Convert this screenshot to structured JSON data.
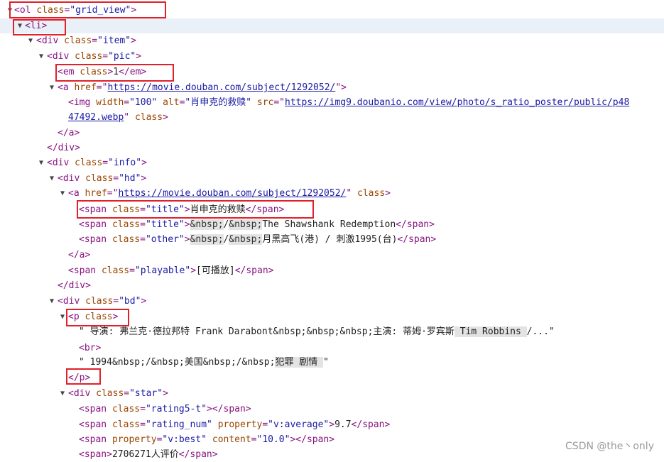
{
  "lines": [
    {
      "arrow": "▼",
      "pieces": [
        [
          "t",
          "<ol "
        ],
        [
          "a",
          "class"
        ],
        [
          "t",
          "="
        ],
        [
          "v",
          "\"grid_view\""
        ],
        [
          "t",
          ">"
        ]
      ]
    },
    {
      "arrow": "▼",
      "selected": true,
      "pieces": [
        [
          "t",
          "<li>"
        ]
      ]
    },
    {
      "arrow": "▼",
      "pieces": [
        [
          "t",
          "<div "
        ],
        [
          "a",
          "class"
        ],
        [
          "t",
          "="
        ],
        [
          "v",
          "\"item\""
        ],
        [
          "t",
          ">"
        ]
      ]
    },
    {
      "arrow": "▼",
      "pieces": [
        [
          "t",
          "<div "
        ],
        [
          "a",
          "class"
        ],
        [
          "t",
          "="
        ],
        [
          "v",
          "\"pic\""
        ],
        [
          "t",
          ">"
        ]
      ]
    },
    {
      "pieces": [
        [
          "t",
          "<em "
        ],
        [
          "a",
          "class"
        ],
        [
          "t",
          ">"
        ],
        [
          "x",
          "1"
        ],
        [
          "t",
          "</em>"
        ]
      ]
    },
    {
      "arrow": "▼",
      "pieces": [
        [
          "t",
          "<a "
        ],
        [
          "a",
          "href"
        ],
        [
          "t",
          "=\""
        ],
        [
          "l",
          "https://movie.douban.com/subject/1292052/"
        ],
        [
          "t",
          "\">"
        ]
      ]
    },
    {
      "pieces": [
        [
          "t",
          "<img "
        ],
        [
          "a",
          "width"
        ],
        [
          "t",
          "="
        ],
        [
          "v",
          "\"100\""
        ],
        [
          "x",
          " "
        ],
        [
          "a",
          "alt"
        ],
        [
          "t",
          "="
        ],
        [
          "v",
          "\"肖申克的救赎\""
        ],
        [
          "x",
          " "
        ],
        [
          "a",
          "src"
        ],
        [
          "t",
          "=\""
        ],
        [
          "l",
          "https://img9.doubanio.com/view/photo/s_ratio_poster/public/p48"
        ]
      ]
    },
    {
      "pieces": [
        [
          "l",
          "47492.webp"
        ],
        [
          "t",
          "\""
        ],
        [
          "x",
          " "
        ],
        [
          "a",
          "class"
        ],
        [
          "t",
          ">"
        ]
      ]
    },
    {
      "pieces": [
        [
          "t",
          "</a>"
        ]
      ]
    },
    {
      "pieces": [
        [
          "t",
          "</div>"
        ]
      ]
    },
    {
      "arrow": "▼",
      "pieces": [
        [
          "t",
          "<div "
        ],
        [
          "a",
          "class"
        ],
        [
          "t",
          "="
        ],
        [
          "v",
          "\"info\""
        ],
        [
          "t",
          ">"
        ]
      ]
    },
    {
      "arrow": "▼",
      "pieces": [
        [
          "t",
          "<div "
        ],
        [
          "a",
          "class"
        ],
        [
          "t",
          "="
        ],
        [
          "v",
          "\"hd\""
        ],
        [
          "t",
          ">"
        ]
      ]
    },
    {
      "arrow": "▼",
      "pieces": [
        [
          "t",
          "<a "
        ],
        [
          "a",
          "href"
        ],
        [
          "t",
          "=\""
        ],
        [
          "l",
          "https://movie.douban.com/subject/1292052/"
        ],
        [
          "t",
          "\""
        ],
        [
          "x",
          " "
        ],
        [
          "a",
          "class"
        ],
        [
          "t",
          ">"
        ]
      ]
    },
    {
      "pieces": [
        [
          "t",
          "<span "
        ],
        [
          "a",
          "class"
        ],
        [
          "t",
          "="
        ],
        [
          "v",
          "\"title\""
        ],
        [
          "t",
          ">"
        ],
        [
          "x",
          "肖申克的救赎"
        ],
        [
          "t",
          "</span>"
        ]
      ]
    },
    {
      "pieces": [
        [
          "t",
          "<span "
        ],
        [
          "a",
          "class"
        ],
        [
          "t",
          "="
        ],
        [
          "v",
          "\"title\""
        ],
        [
          "t",
          ">"
        ],
        [
          "e",
          "&nbsp;"
        ],
        [
          "x",
          "/"
        ],
        [
          "e",
          "&nbsp;"
        ],
        [
          "x",
          "The Shawshank Redemption"
        ],
        [
          "t",
          "</span>"
        ]
      ]
    },
    {
      "pieces": [
        [
          "t",
          "<span "
        ],
        [
          "a",
          "class"
        ],
        [
          "t",
          "="
        ],
        [
          "v",
          "\"other\""
        ],
        [
          "t",
          ">"
        ],
        [
          "e",
          "&nbsp;"
        ],
        [
          "x",
          "/"
        ],
        [
          "e",
          "&nbsp;"
        ],
        [
          "x",
          "月黑高飞(港) / 刺激1995(台)"
        ],
        [
          "t",
          "</span>"
        ]
      ]
    },
    {
      "pieces": [
        [
          "t",
          "</a>"
        ]
      ]
    },
    {
      "pieces": [
        [
          "t",
          "<span "
        ],
        [
          "a",
          "class"
        ],
        [
          "t",
          "="
        ],
        [
          "v",
          "\"playable\""
        ],
        [
          "t",
          ">"
        ],
        [
          "x",
          "[可播放]"
        ],
        [
          "t",
          "</span>"
        ]
      ]
    },
    {
      "pieces": [
        [
          "t",
          "</div>"
        ]
      ]
    },
    {
      "arrow": "▼",
      "pieces": [
        [
          "t",
          "<div "
        ],
        [
          "a",
          "class"
        ],
        [
          "t",
          "="
        ],
        [
          "v",
          "\"bd\""
        ],
        [
          "t",
          ">"
        ]
      ]
    },
    {
      "arrow": "▼",
      "pieces": [
        [
          "t",
          "<p "
        ],
        [
          "a",
          "class"
        ],
        [
          "t",
          ">"
        ]
      ]
    },
    {
      "pieces": [
        [
          "x",
          "\" 导演: 弗兰克·德拉邦特 Frank Darabont&nbsp;&nbsp;&nbsp;主演: 蒂姆·罗宾斯"
        ],
        [
          "h",
          " Tim Robbins "
        ],
        [
          "x",
          "/...\""
        ]
      ]
    },
    {
      "pieces": [
        [
          "t",
          "<br>"
        ]
      ]
    },
    {
      "pieces": [
        [
          "x",
          "\" 1994&nbsp;/&nbsp;美国&nbsp;/&nbsp;"
        ],
        [
          "h",
          "犯罪 剧情 "
        ],
        [
          "x",
          "\""
        ]
      ]
    },
    {
      "pieces": [
        [
          "t",
          "</p>"
        ]
      ]
    },
    {
      "arrow": "▼",
      "pieces": [
        [
          "t",
          "<div "
        ],
        [
          "a",
          "class"
        ],
        [
          "t",
          "="
        ],
        [
          "v",
          "\"star\""
        ],
        [
          "t",
          ">"
        ]
      ]
    },
    {
      "pieces": [
        [
          "t",
          "<span "
        ],
        [
          "a",
          "class"
        ],
        [
          "t",
          "="
        ],
        [
          "v",
          "\"rating5-t\""
        ],
        [
          "t",
          "></span>"
        ]
      ]
    },
    {
      "pieces": [
        [
          "t",
          "<span "
        ],
        [
          "a",
          "class"
        ],
        [
          "t",
          "="
        ],
        [
          "v",
          "\"rating_num\""
        ],
        [
          "x",
          " "
        ],
        [
          "a",
          "property"
        ],
        [
          "t",
          "="
        ],
        [
          "v",
          "\"v:average\""
        ],
        [
          "t",
          ">"
        ],
        [
          "x",
          "9.7"
        ],
        [
          "t",
          "</span>"
        ]
      ]
    },
    {
      "pieces": [
        [
          "t",
          "<span "
        ],
        [
          "a",
          "property"
        ],
        [
          "t",
          "="
        ],
        [
          "v",
          "\"v:best\""
        ],
        [
          "x",
          " "
        ],
        [
          "a",
          "content"
        ],
        [
          "t",
          "="
        ],
        [
          "v",
          "\"10.0\""
        ],
        [
          "t",
          "></span>"
        ]
      ]
    },
    {
      "pieces": [
        [
          "t",
          "<span>"
        ],
        [
          "x",
          "2706271人评价"
        ],
        [
          "t",
          "</span>"
        ]
      ]
    }
  ],
  "watermark": "CSDN @the丶only"
}
